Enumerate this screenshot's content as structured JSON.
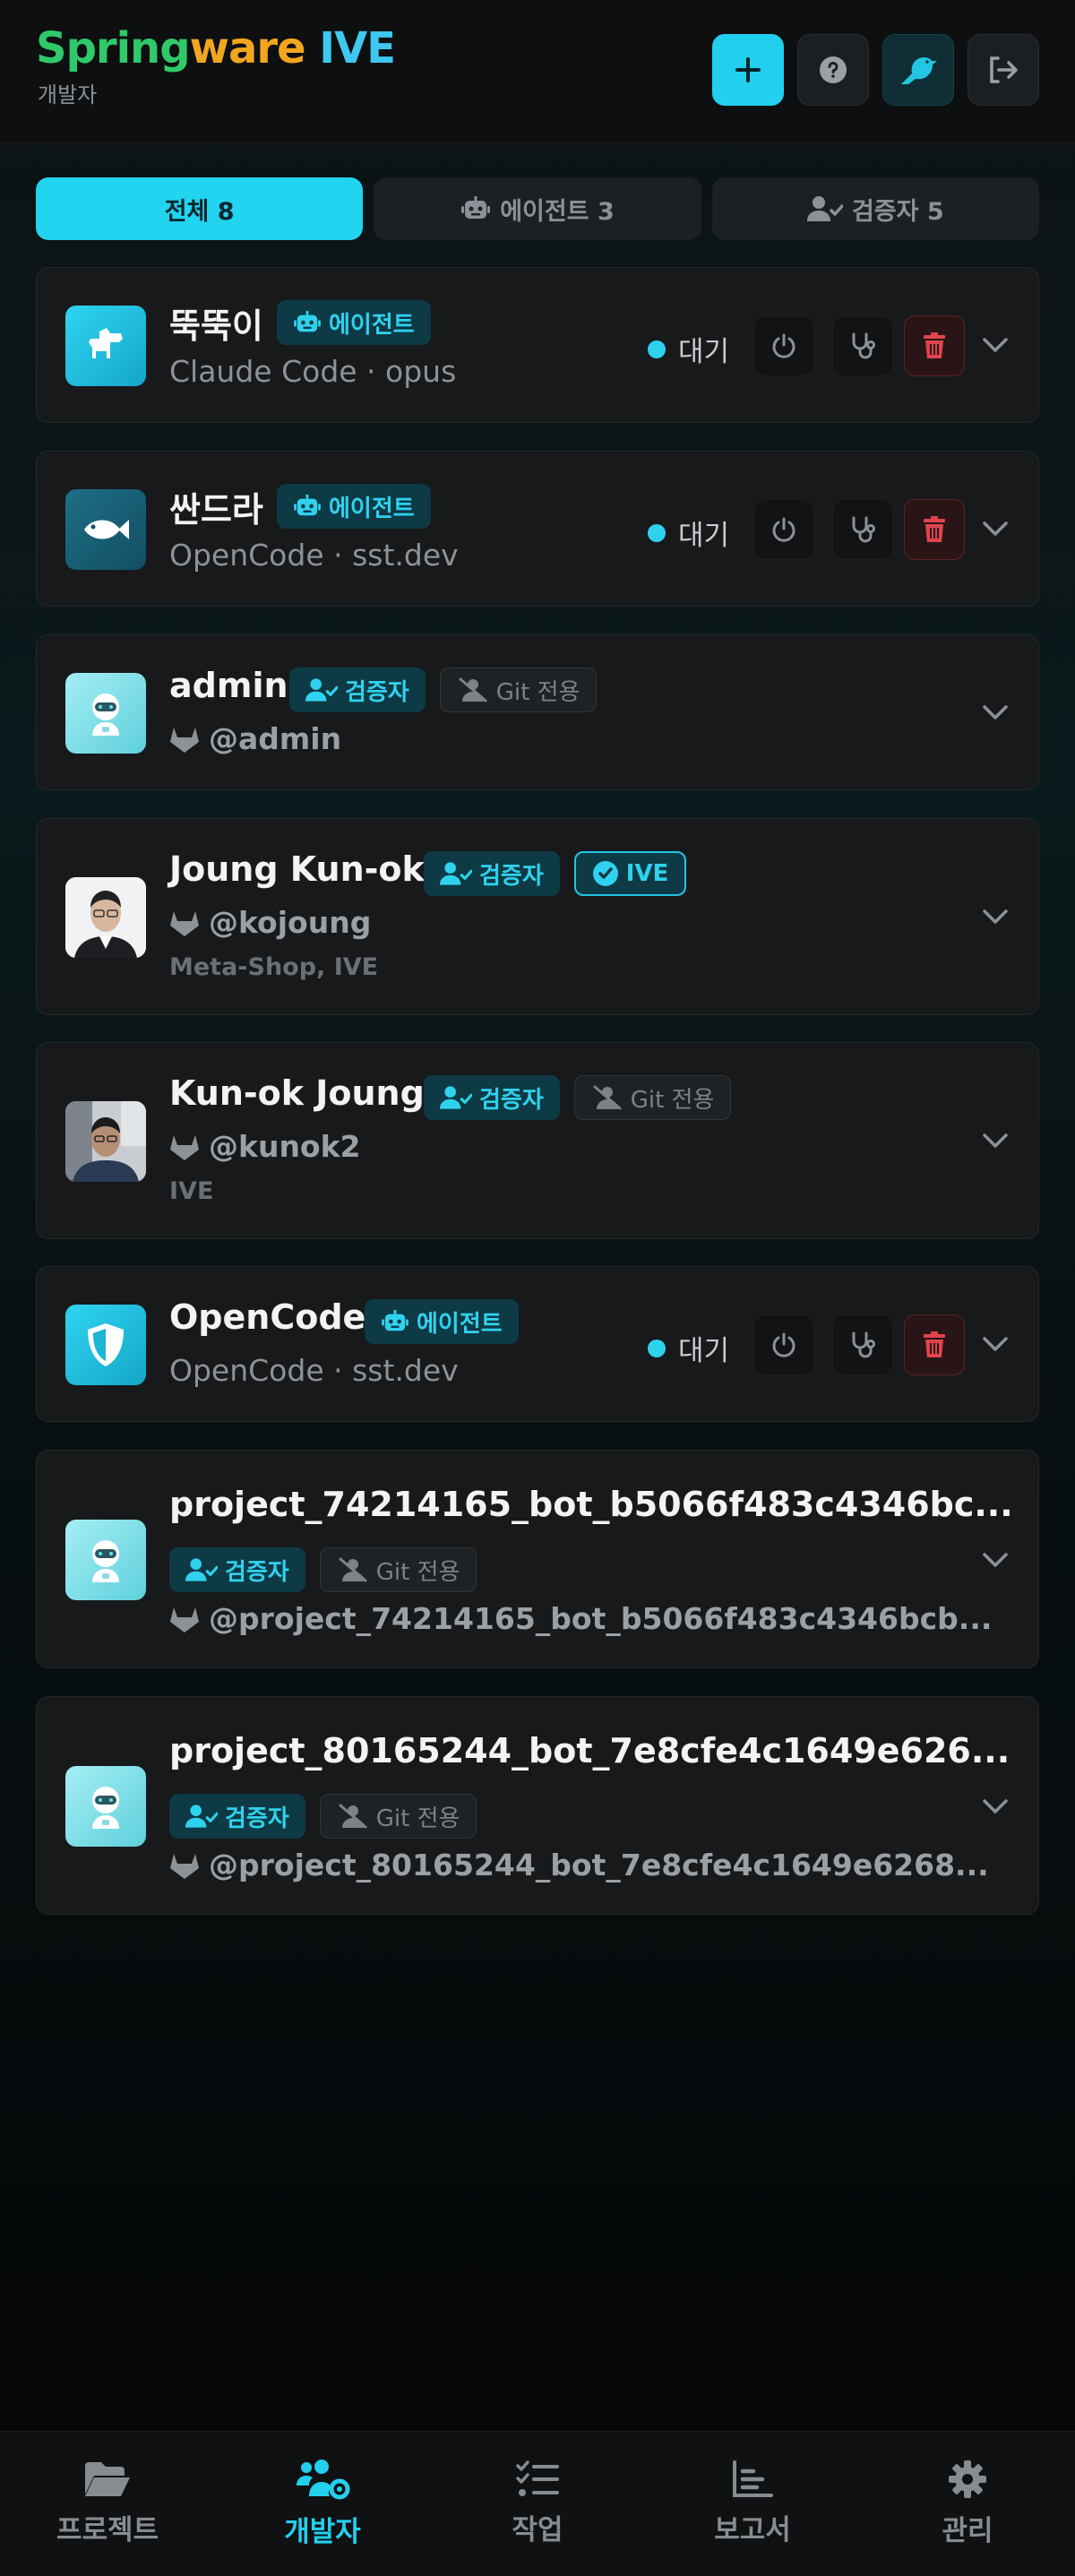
{
  "header": {
    "logo_part1": "Spring",
    "logo_part2": "ware",
    "logo_part3": " IVE",
    "subtitle": "개발자"
  },
  "tabs": [
    {
      "label": "전체 8"
    },
    {
      "label": "에이전트 3"
    },
    {
      "label": "검증자 5"
    }
  ],
  "badge_labels": {
    "agent": "에이전트",
    "verifier": "검증자",
    "git_only": "Git 전용",
    "ive": "IVE"
  },
  "cards": [
    {
      "name": "뚝뚝이",
      "sub": "Claude Code · opus",
      "status": "대기"
    },
    {
      "name": "싼드라",
      "sub": "OpenCode · sst.dev",
      "status": "대기"
    },
    {
      "name": "admin",
      "handle": "@admin"
    },
    {
      "name": "Joung Kun-ok",
      "handle": "@kojoung",
      "org": "Meta-Shop, IVE"
    },
    {
      "name": "Kun-ok Joung",
      "handle": "@kunok2",
      "org": "IVE"
    },
    {
      "name": "OpenCode",
      "sub": "OpenCode · sst.dev",
      "status": "대기"
    },
    {
      "name": "project_74214165_bot_b5066f483c4346bc...",
      "handle": "@project_74214165_bot_b5066f483c4346bcb..."
    },
    {
      "name": "project_80165244_bot_7e8cfe4c1649e626...",
      "handle": "@project_80165244_bot_7e8cfe4c1649e6268..."
    }
  ],
  "nav": [
    {
      "label": "프로젝트"
    },
    {
      "label": "개발자"
    },
    {
      "label": "작업"
    },
    {
      "label": "보고서"
    },
    {
      "label": "관리"
    }
  ],
  "colors": {
    "accent": "#22d0ee",
    "logo_green": "#2fc96a",
    "logo_orange": "#f2a51f",
    "logo_blue": "#3fc7f0",
    "delete_red": "#e0444c"
  }
}
